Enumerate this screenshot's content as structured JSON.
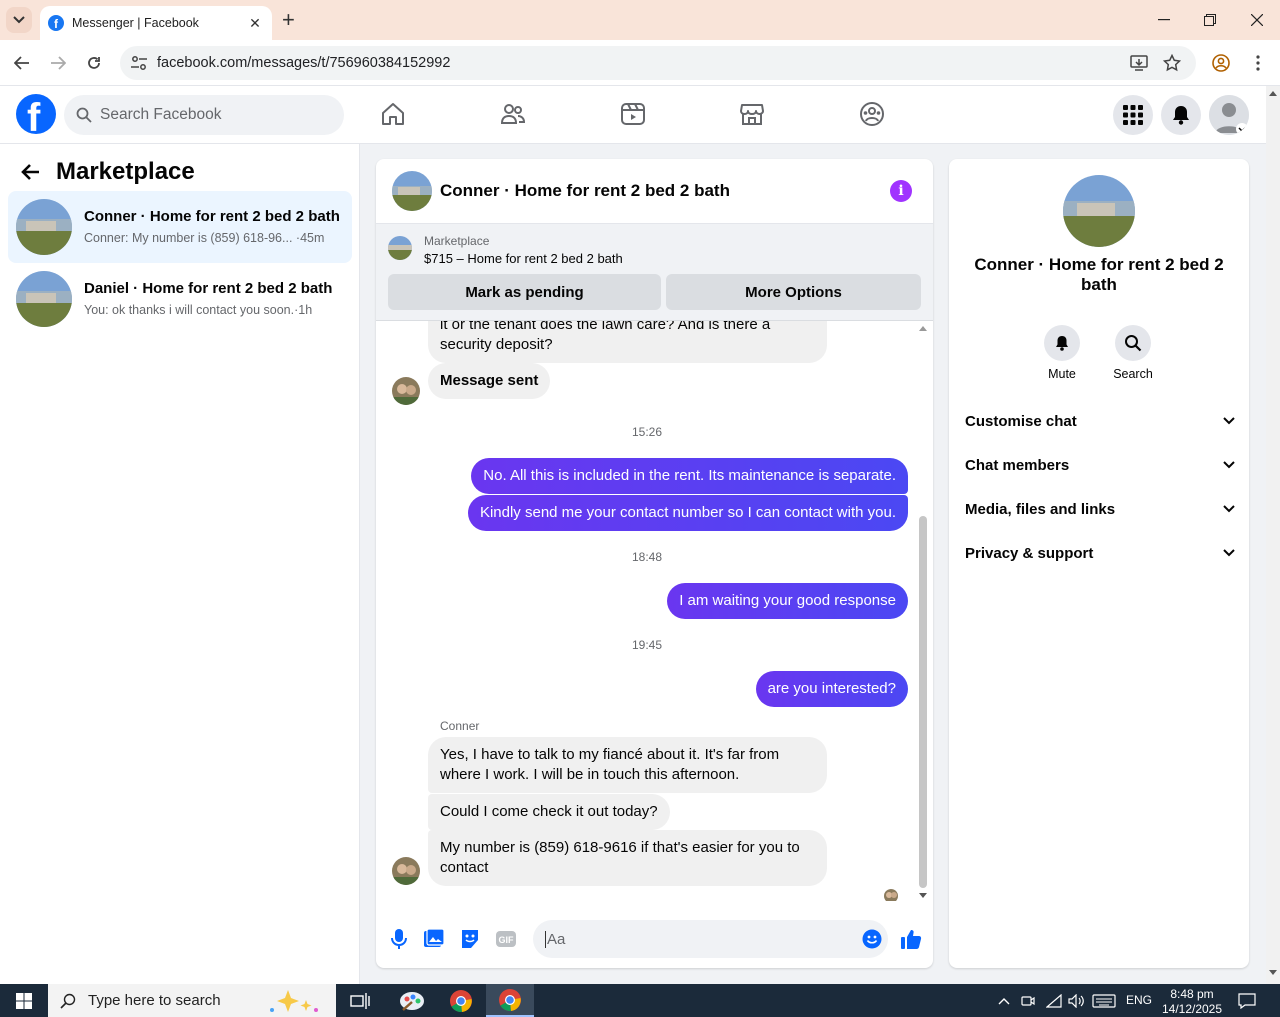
{
  "browser": {
    "tab_title": "Messenger | Facebook",
    "url": "facebook.com/messages/t/756960384152992"
  },
  "header": {
    "search_placeholder": "Search Facebook"
  },
  "sidebar": {
    "title": "Marketplace",
    "conversations": [
      {
        "name": "Conner · Home for rent 2 bed 2 bath",
        "preview": "Conner: My number is (859) 618-96...",
        "time": "·45m",
        "active": true
      },
      {
        "name": "Daniel · Home for rent 2 bed 2 bath",
        "preview": "You: ok thanks i will contact you soon.",
        "time": "·1h",
        "active": false
      }
    ]
  },
  "chat": {
    "title": "Conner · Home for rent 2 bed 2 bath",
    "banner": {
      "label": "Marketplace",
      "listing": "$715 – Home for rent 2 bed 2 bath",
      "btn_pending": "Mark as pending",
      "btn_options": "More Options"
    },
    "messages": {
      "partial": "it or the tenant does the lawn care? And is there a",
      "partial2": "security deposit?",
      "sent_notice": "Message sent",
      "ts1": "15:26",
      "out1": "No. All this is included in the rent. Its maintenance is separate.",
      "out2": "Kindly send me your contact number so I can contact with you.",
      "ts2": "18:48",
      "out3": "I am waiting your good response",
      "ts3": "19:45",
      "out4": "are you interested?",
      "sender": "Conner",
      "in1a": "Yes, I have to talk to my fiancé about it. It's far from",
      "in1b": "where I work. I will be in touch this afternoon.",
      "in2": "Could I come check it out today?",
      "in3a": "My number is (859) 618-9616 if that's easier for you to",
      "in3b": "contact"
    },
    "composer_placeholder": "Aa"
  },
  "details": {
    "name": "Conner · Home for rent 2 bed 2 bath",
    "actions": {
      "mute": "Mute",
      "search": "Search"
    },
    "sections": [
      "Customise chat",
      "Chat members",
      "Media, files and links",
      "Privacy & support"
    ]
  },
  "taskbar": {
    "search_placeholder": "Type here to search",
    "lang": "ENG",
    "time": "8:48 pm",
    "date": "14/12/2025"
  },
  "colors": {
    "fb_blue": "#0866ff",
    "messenger_purple": "#5b3ef5",
    "active_conv_bg": "#ebf5ff"
  }
}
